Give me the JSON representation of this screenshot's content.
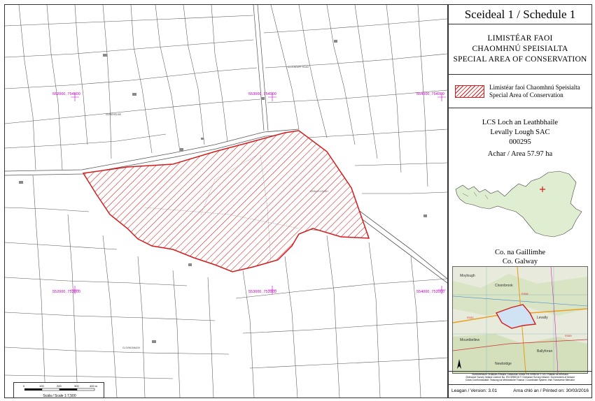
{
  "panel": {
    "title": "Sceideal 1 / Schedule 1",
    "heading_line1": "LIMISTÉAR FAOI",
    "heading_line2": "CHAOMHNÚ SPEISIALTA",
    "heading_line3": "SPECIAL AREA OF CONSERVATION",
    "legend_line1": "Limistéar faoi Chaomhnú Speisialta",
    "legend_line2": "Special Area of Conservation",
    "site_name_irish": "LCS Loch an Leathbhaile",
    "site_name_english": "Levally Lough SAC",
    "site_code": "000295",
    "area": "Achar / Area 57.97 ha",
    "county_irish": "Co. na Gaillimhe",
    "county_english": "Co. Galway",
    "copyright_line1": "Suirbhéireacht Ordanáis Éireann Ceadúnas Uimhir EN 0095016 © OS / Rialtas na hÉireann",
    "copyright_line2": "Ordnance Survey Ireland Licence No. EN 0095016 © Ordnance Survey Ireland / Government of Ireland",
    "copyright_line3": "Córas Comhordanáidí: Teascóg na Meirceatóire Trasnaí / Coordinate System: Irish Transverse Mercator",
    "version": "Leagan / Version: 3.01",
    "printed": "Arna chló an / Printed on: 30/03/2016"
  },
  "map": {
    "grid_labels": [
      "552000, 754000",
      "553000, 754000",
      "554000, 754000",
      "552000, 753000",
      "553000, 753000",
      "554000, 753000"
    ],
    "place_labels": [
      "GLEBEHOUSE",
      "CLOONDUFF ROAD",
      "LEVALLY LOUGH",
      "CLOONDANAGH"
    ],
    "sac_color": "#d21c1c",
    "grid_color": "#c000c0"
  },
  "scale": {
    "ticks": [
      "0",
      "100",
      "200",
      "300",
      "400 m"
    ],
    "label": "Scála / Scale 1:7,500"
  },
  "inset": {
    "place_labels": [
      "Moylough",
      "Cloonbrook",
      "Levally",
      "Mountbellew",
      "Ballyforan",
      "Newbridge"
    ],
    "road_labels": [
      "R332",
      "R358",
      "R359"
    ]
  }
}
